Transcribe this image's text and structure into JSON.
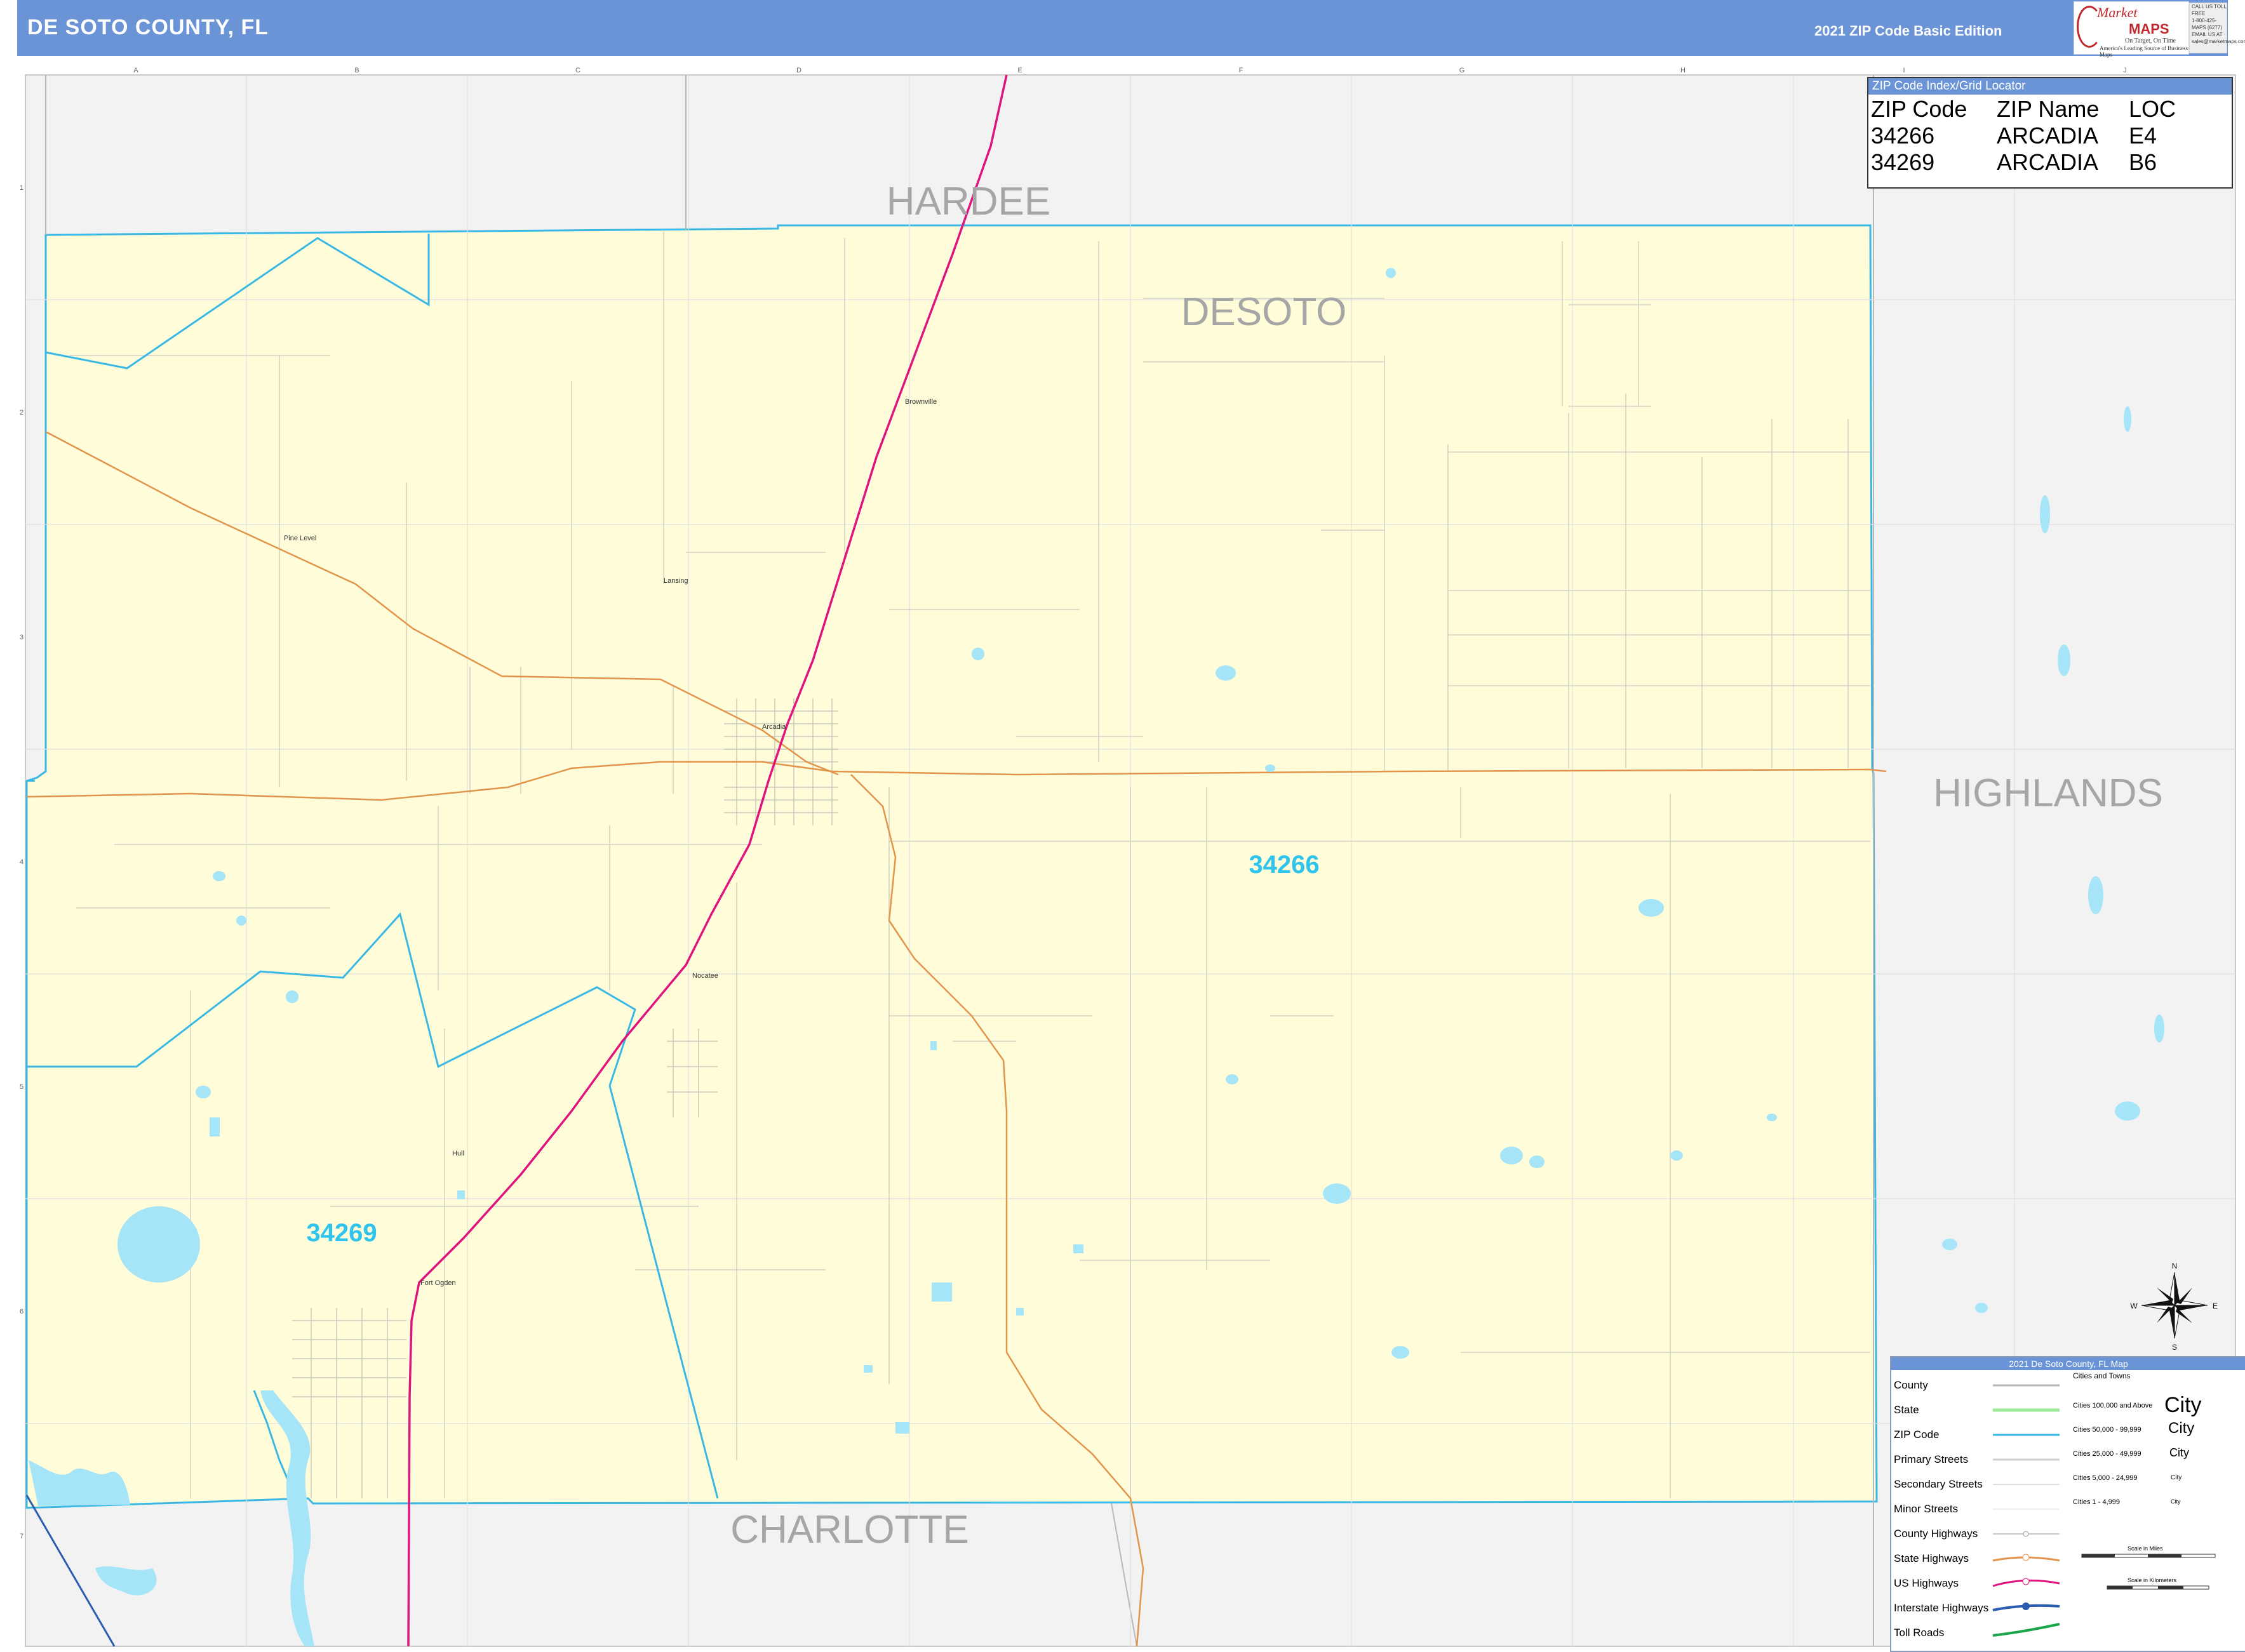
{
  "header": {
    "title": "DE SOTO COUNTY, FL",
    "edition": "2021 ZIP Code Basic Edition",
    "logo_brand_1": "Market",
    "logo_brand_2": "MAPS",
    "logo_tagline_1": "On Target, On Time",
    "logo_tagline_2": "America's Leading Source of Business Maps",
    "phone_lines": [
      "CALL US TOLL FREE",
      "1-800-425-MAPS (6277)",
      "EMAIL US AT",
      "sales@marketmaps.com"
    ],
    "header_color": "#6b94d6",
    "logo_color": "#c0282d"
  },
  "zip_index": {
    "title": "ZIP Code Index/Grid Locator",
    "columns": [
      "ZIP Code",
      "ZIP Name",
      "LOC"
    ],
    "rows": [
      [
        "34266",
        "ARCADIA",
        "E4"
      ],
      [
        "34269",
        "ARCADIA",
        "B6"
      ]
    ]
  },
  "map": {
    "county_fill": "#fefcd9",
    "outside_fill": "#f2f2f2",
    "zip_boundary_color": "#39b8e6",
    "water_color": "#a6e4f8",
    "us_highway_color": "#e0147e",
    "state_highway_color": "#e2944a",
    "grid_columns": [
      "A",
      "B",
      "C",
      "D",
      "E",
      "F",
      "G",
      "H",
      "I",
      "J"
    ],
    "grid_rows": [
      "1",
      "2",
      "3",
      "4",
      "5",
      "6",
      "7"
    ],
    "county_labels": [
      {
        "name": "HARDEE"
      },
      {
        "name": "DESOTO"
      },
      {
        "name": "HIGHLANDS"
      },
      {
        "name": "CHARLOTTE"
      }
    ],
    "zip_labels": [
      {
        "zip": "34266"
      },
      {
        "zip": "34269"
      }
    ],
    "towns": [
      "Brownville",
      "Pine Level",
      "Lansing",
      "Arcadia",
      "Nocatee",
      "Hull",
      "Fort Ogden"
    ]
  },
  "compass": {
    "north": "N",
    "south": "S",
    "east": "E",
    "west": "W"
  },
  "legend": {
    "title": "2021 De Soto County, FL Map",
    "line_items": [
      {
        "label": "County",
        "color": "#b5b5b5"
      },
      {
        "label": "State",
        "color": "#9ee89a"
      },
      {
        "label": "ZIP Code",
        "color": "#39b8e6"
      },
      {
        "label": "Primary Streets",
        "color": "#cfcfcf"
      },
      {
        "label": "Secondary Streets",
        "color": "#dedede"
      },
      {
        "label": "Minor Streets",
        "color": "#ececec"
      },
      {
        "label": "County Highways",
        "color": "#c9c9c9"
      },
      {
        "label": "State Highways",
        "color": "#e2944a"
      },
      {
        "label": "US Highways",
        "color": "#e0147e"
      },
      {
        "label": "Interstate Highways",
        "color": "#2a5db0"
      },
      {
        "label": "Toll Roads",
        "color": "#1aa64a"
      }
    ],
    "cities_header": "Cities and Towns",
    "city_classes": [
      {
        "label": "Cities 100,000 and Above",
        "sample": "City"
      },
      {
        "label": "Cities 50,000 - 99,999",
        "sample": "City"
      },
      {
        "label": "Cities 25,000 - 49,999",
        "sample": "City"
      },
      {
        "label": "Cities 5,000 - 24,999",
        "sample": "City"
      },
      {
        "label": "Cities 1 - 4,999",
        "sample": "City"
      }
    ],
    "scale_miles": "Scale in Miles",
    "scale_km": "Scale in Kilometers"
  }
}
